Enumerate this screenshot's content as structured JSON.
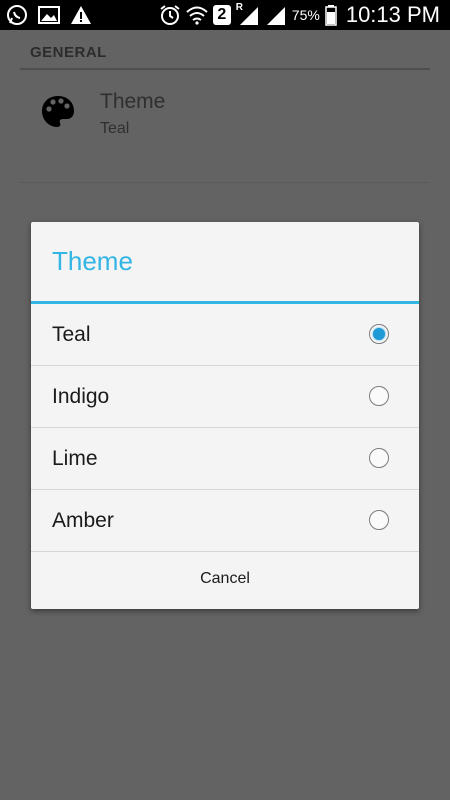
{
  "status_bar": {
    "badge": "2",
    "roaming": "R",
    "battery": "75%",
    "time": "10:13 PM",
    "icons": [
      "whatsapp-icon",
      "image-icon",
      "warning-icon",
      "alarm-icon",
      "wifi-icon",
      "sim-badge",
      "signal-icon",
      "signal-icon-2",
      "battery-icon"
    ]
  },
  "settings": {
    "section_header": "GENERAL",
    "theme_pref": {
      "title": "Theme",
      "summary": "Teal",
      "icon": "palette-icon"
    }
  },
  "dialog": {
    "title": "Theme",
    "options": [
      {
        "label": "Teal",
        "checked": true
      },
      {
        "label": "Indigo",
        "checked": false
      },
      {
        "label": "Lime",
        "checked": false
      },
      {
        "label": "Amber",
        "checked": false
      }
    ],
    "cancel_label": "Cancel"
  },
  "colors": {
    "accent": "#33b5e5",
    "radio_checked": "#1f9ad6",
    "scrim": "#636363"
  }
}
